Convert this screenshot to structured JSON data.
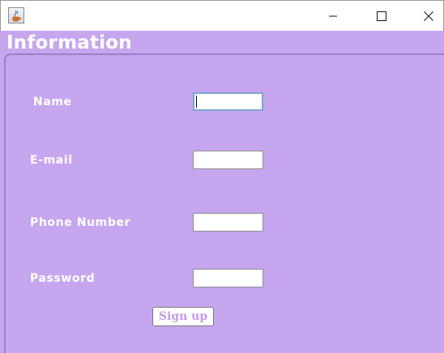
{
  "window": {
    "heading": "Information",
    "controls": {
      "minimize_icon": "minimize-icon",
      "maximize_icon": "maximize-icon",
      "close_icon": "close-icon"
    },
    "app_icon": "java-app-icon"
  },
  "form": {
    "fields": [
      {
        "label": "Name",
        "value": "",
        "focused": true
      },
      {
        "label": "E-mail",
        "value": ""
      },
      {
        "label": "Phone Number",
        "value": ""
      },
      {
        "label": "Password",
        "value": ""
      }
    ],
    "submit_label": "Sign up"
  },
  "colors": {
    "background": "#c6a6ee",
    "label_text": "#ffffff",
    "button_text": "#c39bea",
    "focus_border": "#7ea6cf"
  }
}
